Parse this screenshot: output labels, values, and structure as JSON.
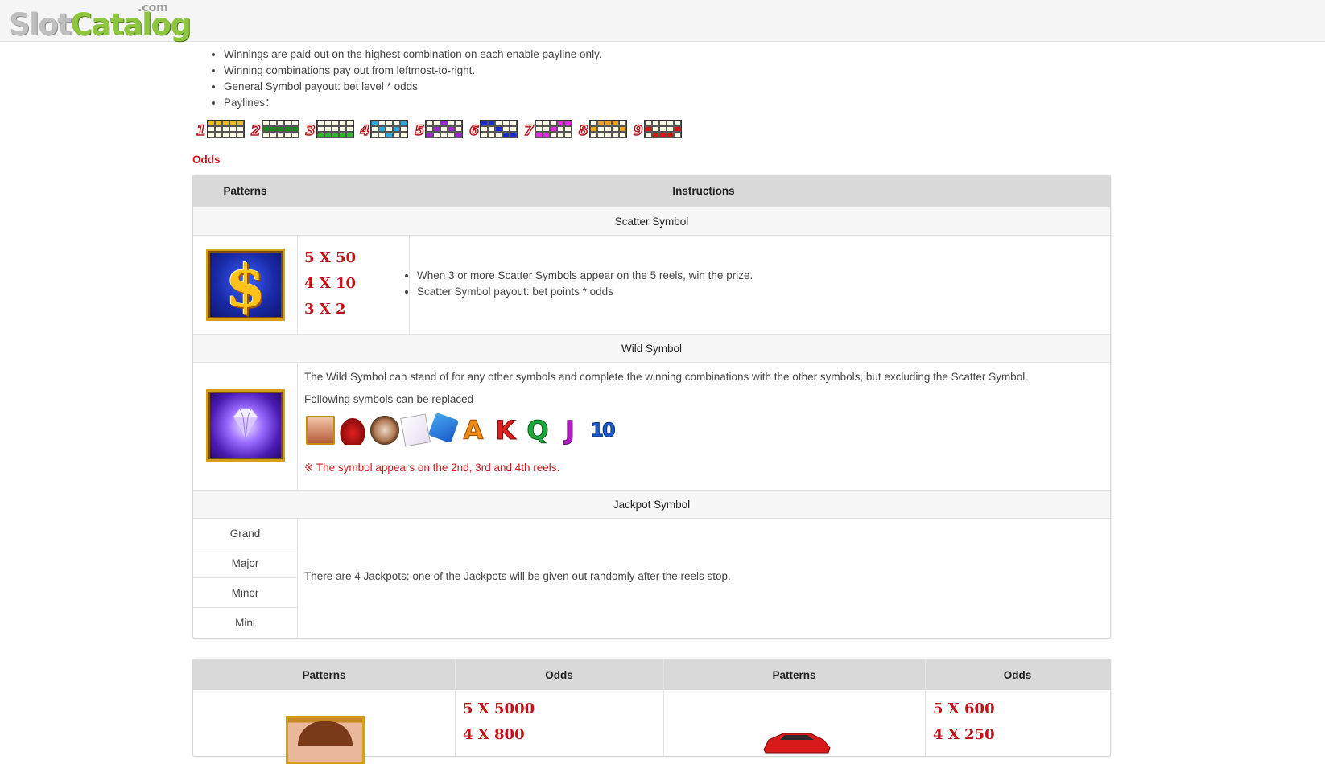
{
  "header": {
    "logo_part1": "Slot",
    "logo_part2": "Catalog",
    "logo_suffix": ".com"
  },
  "rules": [
    "Winnings are paid out on the highest combination on each enable payline only.",
    "Winning combinations pay out from leftmost-to-right.",
    "General Symbol payout: bet level * odds",
    "Paylines："
  ],
  "paylines": [
    {
      "num": "1",
      "color": "#e8c020"
    },
    {
      "num": "2",
      "color": "#1a8a1a"
    },
    {
      "num": "3",
      "color": "#2ab82a"
    },
    {
      "num": "4",
      "color": "#2aa8e0"
    },
    {
      "num": "5",
      "color": "#9a2ad0"
    },
    {
      "num": "6",
      "color": "#1a2ad0"
    },
    {
      "num": "7",
      "color": "#e02ae0"
    },
    {
      "num": "8",
      "color": "#f0a020"
    },
    {
      "num": "9",
      "color": "#d01a1a"
    }
  ],
  "odds_title": "Odds",
  "table": {
    "header": {
      "patterns": "Patterns",
      "instructions": "Instructions"
    },
    "scatter": {
      "section": "Scatter Symbol",
      "icon": "dollar-coin-icon",
      "odds": [
        "5 X 50",
        "4 X 10",
        "3 X 2"
      ],
      "instructions": [
        "When 3 or more Scatter Symbols appear on the 5 reels, win the prize.",
        "Scatter Symbol payout: bet points * odds"
      ]
    },
    "wild": {
      "section": "Wild Symbol",
      "icon": "diamond-icon",
      "text": "The Wild Symbol can stand of for any other symbols and complete the winning combinations with the other symbols, but excluding the Scatter Symbol.",
      "text2": "Following symbols can be replaced",
      "replace_icons": [
        "woman-icon",
        "red-car-icon",
        "watch-icon",
        "cards-icon",
        "dice-icon",
        "A",
        "K",
        "Q",
        "J",
        "10"
      ],
      "note": "※ The symbol appears on the 2nd, 3rd and 4th reels."
    },
    "jackpot": {
      "section": "Jackpot Symbol",
      "levels": [
        "Grand",
        "Major",
        "Minor",
        "Mini"
      ],
      "text": "There are 4 Jackpots: one of the Jackpots will be given out randomly after the reels stop."
    }
  },
  "table2": {
    "headers": [
      "Patterns",
      "Odds",
      "Patterns",
      "Odds"
    ],
    "left_odds": [
      "5 X 5000",
      "4 X 800"
    ],
    "right_odds": [
      "5 X 600",
      "4 X 250"
    ]
  },
  "colors": {
    "accent_red": "#d2141e",
    "odds_red": "#c0121a",
    "header_gray": "#d9d9d9"
  }
}
